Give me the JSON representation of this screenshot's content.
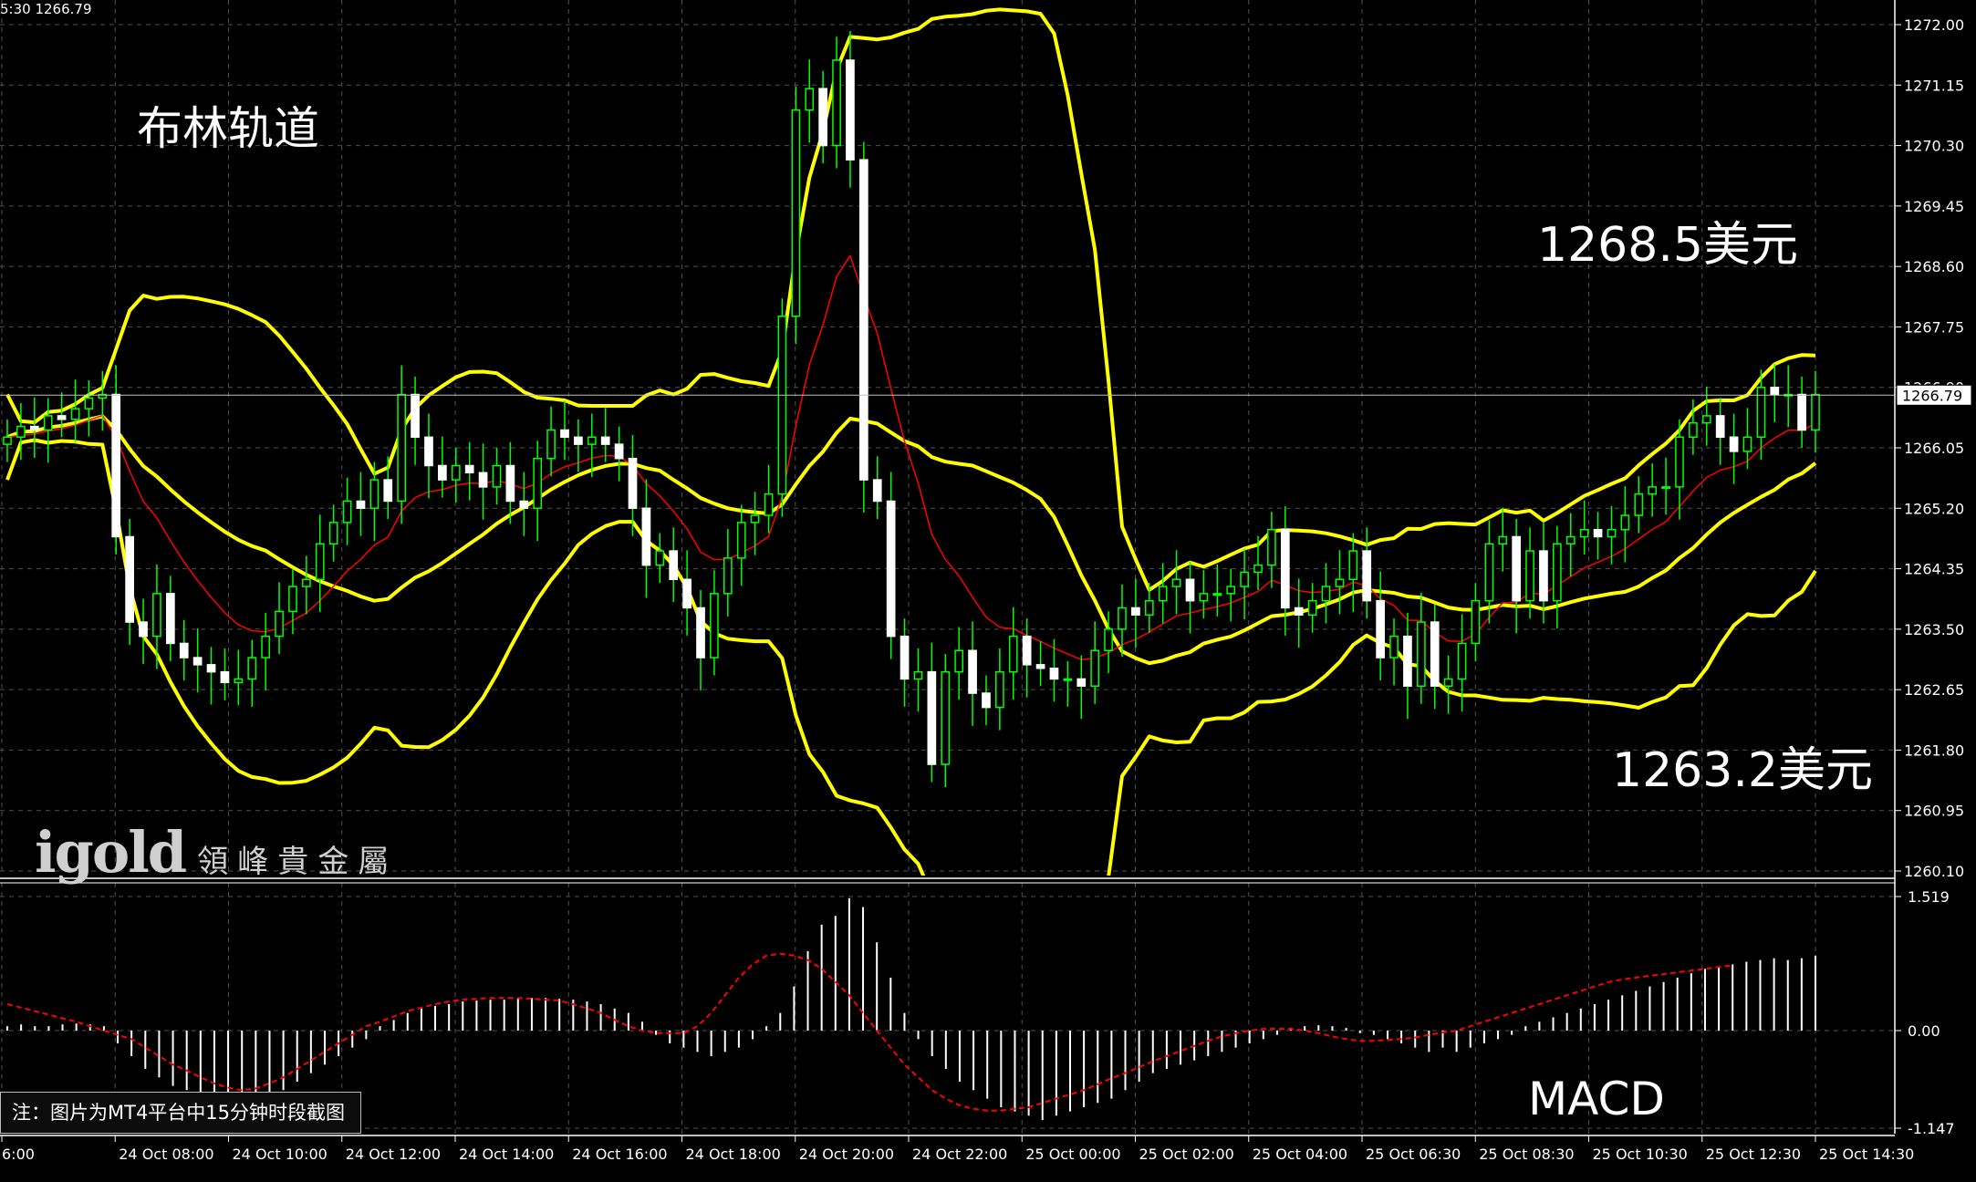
{
  "header": {
    "info": "5:30 1266.79"
  },
  "annotations": {
    "title": "布林轨道",
    "upper_target": "1268.5美元",
    "lower_target": "1263.2美元",
    "macd": "MACD"
  },
  "note": "注：图片为MT4平台中15分钟时段截图",
  "logo": {
    "main": "igold",
    "sub": "領峰貴金屬"
  },
  "colors": {
    "background": "#000000",
    "bullish": "#00ff00",
    "bearish": "#ffffff",
    "bollinger": "#ffff00",
    "moving_average": "#ff0000",
    "macd_signal": "#ff0000",
    "grid": "#505050"
  },
  "chart_data": [
    {
      "type": "candlestick",
      "title": "布林轨道",
      "ylim": [
        1260.1,
        1272.0
      ],
      "y_ticks": [
        "1272.00",
        "1271.15",
        "1270.30",
        "1269.45",
        "1268.60",
        "1267.75",
        "1266.90",
        "1266.05",
        "1265.20",
        "1264.35",
        "1263.50",
        "1262.65",
        "1261.80",
        "1260.95",
        "1260.10"
      ],
      "y_tick_values": [
        1272.0,
        1271.15,
        1270.3,
        1269.45,
        1268.6,
        1267.75,
        1266.9,
        1266.05,
        1265.2,
        1264.35,
        1263.5,
        1262.65,
        1261.8,
        1260.95,
        1260.1
      ],
      "current_price": "1266.79",
      "current_price_value": 1266.79,
      "x_ticks": [
        "6:00",
        "24 Oct 08:00",
        "24 Oct 10:00",
        "24 Oct 12:00",
        "24 Oct 14:00",
        "24 Oct 16:00",
        "24 Oct 18:00",
        "24 Oct 20:00",
        "24 Oct 22:00",
        "25 Oct 00:00",
        "25 Oct 02:00",
        "25 Oct 04:00",
        "25 Oct 06:30",
        "25 Oct 08:30",
        "25 Oct 10:30",
        "25 Oct 12:30",
        "25 Oct 14:30"
      ],
      "close": [
        1266.2,
        1266.35,
        1266.3,
        1266.5,
        1266.45,
        1266.6,
        1266.75,
        1266.8,
        1264.8,
        1263.6,
        1263.4,
        1264.0,
        1263.3,
        1263.1,
        1263.0,
        1262.9,
        1262.75,
        1262.8,
        1263.1,
        1263.4,
        1263.75,
        1264.1,
        1264.2,
        1264.7,
        1265.0,
        1265.3,
        1265.2,
        1265.6,
        1265.3,
        1266.8,
        1266.2,
        1265.8,
        1265.6,
        1265.8,
        1265.7,
        1265.5,
        1265.8,
        1265.3,
        1265.2,
        1265.9,
        1266.3,
        1266.2,
        1266.1,
        1266.2,
        1266.1,
        1265.9,
        1265.2,
        1264.4,
        1264.6,
        1264.2,
        1263.8,
        1263.1,
        1264.0,
        1264.5,
        1265.0,
        1265.1,
        1265.4,
        1267.9,
        1270.8,
        1271.1,
        1270.3,
        1271.5,
        1270.1,
        1265.6,
        1265.3,
        1263.4,
        1262.8,
        1262.9,
        1261.6,
        1262.9,
        1263.2,
        1262.6,
        1262.4,
        1262.9,
        1263.4,
        1263.0,
        1262.95,
        1262.8,
        1262.8,
        1262.7,
        1263.2,
        1263.5,
        1263.8,
        1263.7,
        1263.9,
        1264.1,
        1264.2,
        1263.9,
        1264.0,
        1264.0,
        1264.1,
        1264.3,
        1264.4,
        1264.9,
        1263.8,
        1263.7,
        1263.9,
        1264.1,
        1264.2,
        1264.6,
        1263.9,
        1263.1,
        1263.4,
        1262.7,
        1263.6,
        1262.7,
        1262.8,
        1263.3,
        1263.9,
        1264.7,
        1264.8,
        1263.9,
        1264.6,
        1263.9,
        1264.7,
        1264.8,
        1264.9,
        1264.8,
        1264.9,
        1265.1,
        1265.4,
        1265.5,
        1265.5,
        1266.2,
        1266.4,
        1266.5,
        1266.2,
        1266.0,
        1266.2,
        1266.9,
        1266.8,
        1266.8,
        1266.3,
        1266.8
      ],
      "bollinger_upper": "1268.5美元",
      "bollinger_lower": "1263.2美元"
    },
    {
      "type": "histogram",
      "title": "MACD",
      "ylim": [
        -1.147,
        1.519
      ],
      "y_ticks": [
        "1.519",
        "0.00",
        "-1.147"
      ],
      "y_tick_values": [
        1.519,
        0.0,
        -1.147
      ],
      "histogram": [
        0.05,
        0.07,
        0.05,
        0.05,
        0.07,
        0.08,
        0.07,
        0.05,
        -0.15,
        -0.3,
        -0.45,
        -0.55,
        -0.65,
        -0.7,
        -0.75,
        -0.8,
        -0.8,
        -0.75,
        -0.75,
        -0.72,
        -0.7,
        -0.6,
        -0.5,
        -0.4,
        -0.3,
        -0.2,
        -0.1,
        0.05,
        0.12,
        0.2,
        0.25,
        0.28,
        0.3,
        0.33,
        0.34,
        0.35,
        0.35,
        0.36,
        0.37,
        0.37,
        0.36,
        0.35,
        0.33,
        0.3,
        0.25,
        0.2,
        0.1,
        -0.05,
        -0.15,
        -0.2,
        -0.25,
        -0.3,
        -0.25,
        -0.2,
        -0.1,
        0.05,
        0.2,
        0.5,
        0.9,
        1.2,
        1.3,
        1.5,
        1.4,
        1.0,
        0.6,
        0.2,
        -0.1,
        -0.3,
        -0.45,
        -0.6,
        -0.7,
        -0.8,
        -0.9,
        -0.95,
        -1.0,
        -1.05,
        -1.0,
        -0.95,
        -0.9,
        -0.85,
        -0.8,
        -0.7,
        -0.6,
        -0.5,
        -0.45,
        -0.4,
        -0.35,
        -0.3,
        -0.25,
        -0.2,
        -0.15,
        -0.1,
        -0.05,
        0.03,
        0.05,
        0.06,
        0.05,
        0.03,
        -0.03,
        -0.05,
        -0.1,
        -0.15,
        -0.2,
        -0.25,
        -0.2,
        -0.25,
        -0.2,
        -0.15,
        -0.1,
        -0.05,
        0.05,
        0.1,
        0.15,
        0.2,
        0.25,
        0.3,
        0.35,
        0.4,
        0.45,
        0.5,
        0.55,
        0.6,
        0.65,
        0.7,
        0.72,
        0.75,
        0.78,
        0.8,
        0.82,
        0.8,
        0.82,
        0.85
      ],
      "signal": [
        0.3,
        0.26,
        0.22,
        0.18,
        0.14,
        0.1,
        0.05,
        0.0,
        -0.05,
        -0.1,
        -0.2,
        -0.3,
        -0.4,
        -0.47,
        -0.55,
        -0.62,
        -0.67,
        -0.7,
        -0.68,
        -0.62,
        -0.55,
        -0.45,
        -0.35,
        -0.25,
        -0.15,
        -0.05,
        0.05,
        0.1,
        0.16,
        0.22,
        0.26,
        0.3,
        0.33,
        0.35,
        0.36,
        0.37,
        0.37,
        0.37,
        0.36,
        0.35,
        0.34,
        0.3,
        0.25,
        0.2,
        0.12,
        0.05,
        0.0,
        -0.03,
        -0.03,
        -0.03,
        0.05,
        0.2,
        0.4,
        0.6,
        0.75,
        0.85,
        0.87,
        0.85,
        0.8,
        0.7,
        0.55,
        0.4,
        0.2,
        0.0,
        -0.2,
        -0.4,
        -0.55,
        -0.7,
        -0.8,
        -0.88,
        -0.92,
        -0.94,
        -0.94,
        -0.92,
        -0.9,
        -0.85,
        -0.8,
        -0.75,
        -0.7,
        -0.63,
        -0.56,
        -0.5,
        -0.43,
        -0.36,
        -0.3,
        -0.24,
        -0.18,
        -0.12,
        -0.07,
        -0.03,
        0.0,
        0.02,
        0.02,
        0.02,
        0.0,
        -0.03,
        -0.07,
        -0.1,
        -0.12,
        -0.12,
        -0.11,
        -0.1,
        -0.08,
        -0.05,
        -0.02,
        0.0,
        0.05,
        0.1,
        0.15,
        0.2,
        0.25,
        0.3,
        0.35,
        0.4,
        0.45,
        0.5,
        0.55,
        0.58,
        0.6,
        0.62,
        0.64,
        0.66,
        0.68,
        0.7,
        0.72,
        0.74
      ]
    }
  ]
}
